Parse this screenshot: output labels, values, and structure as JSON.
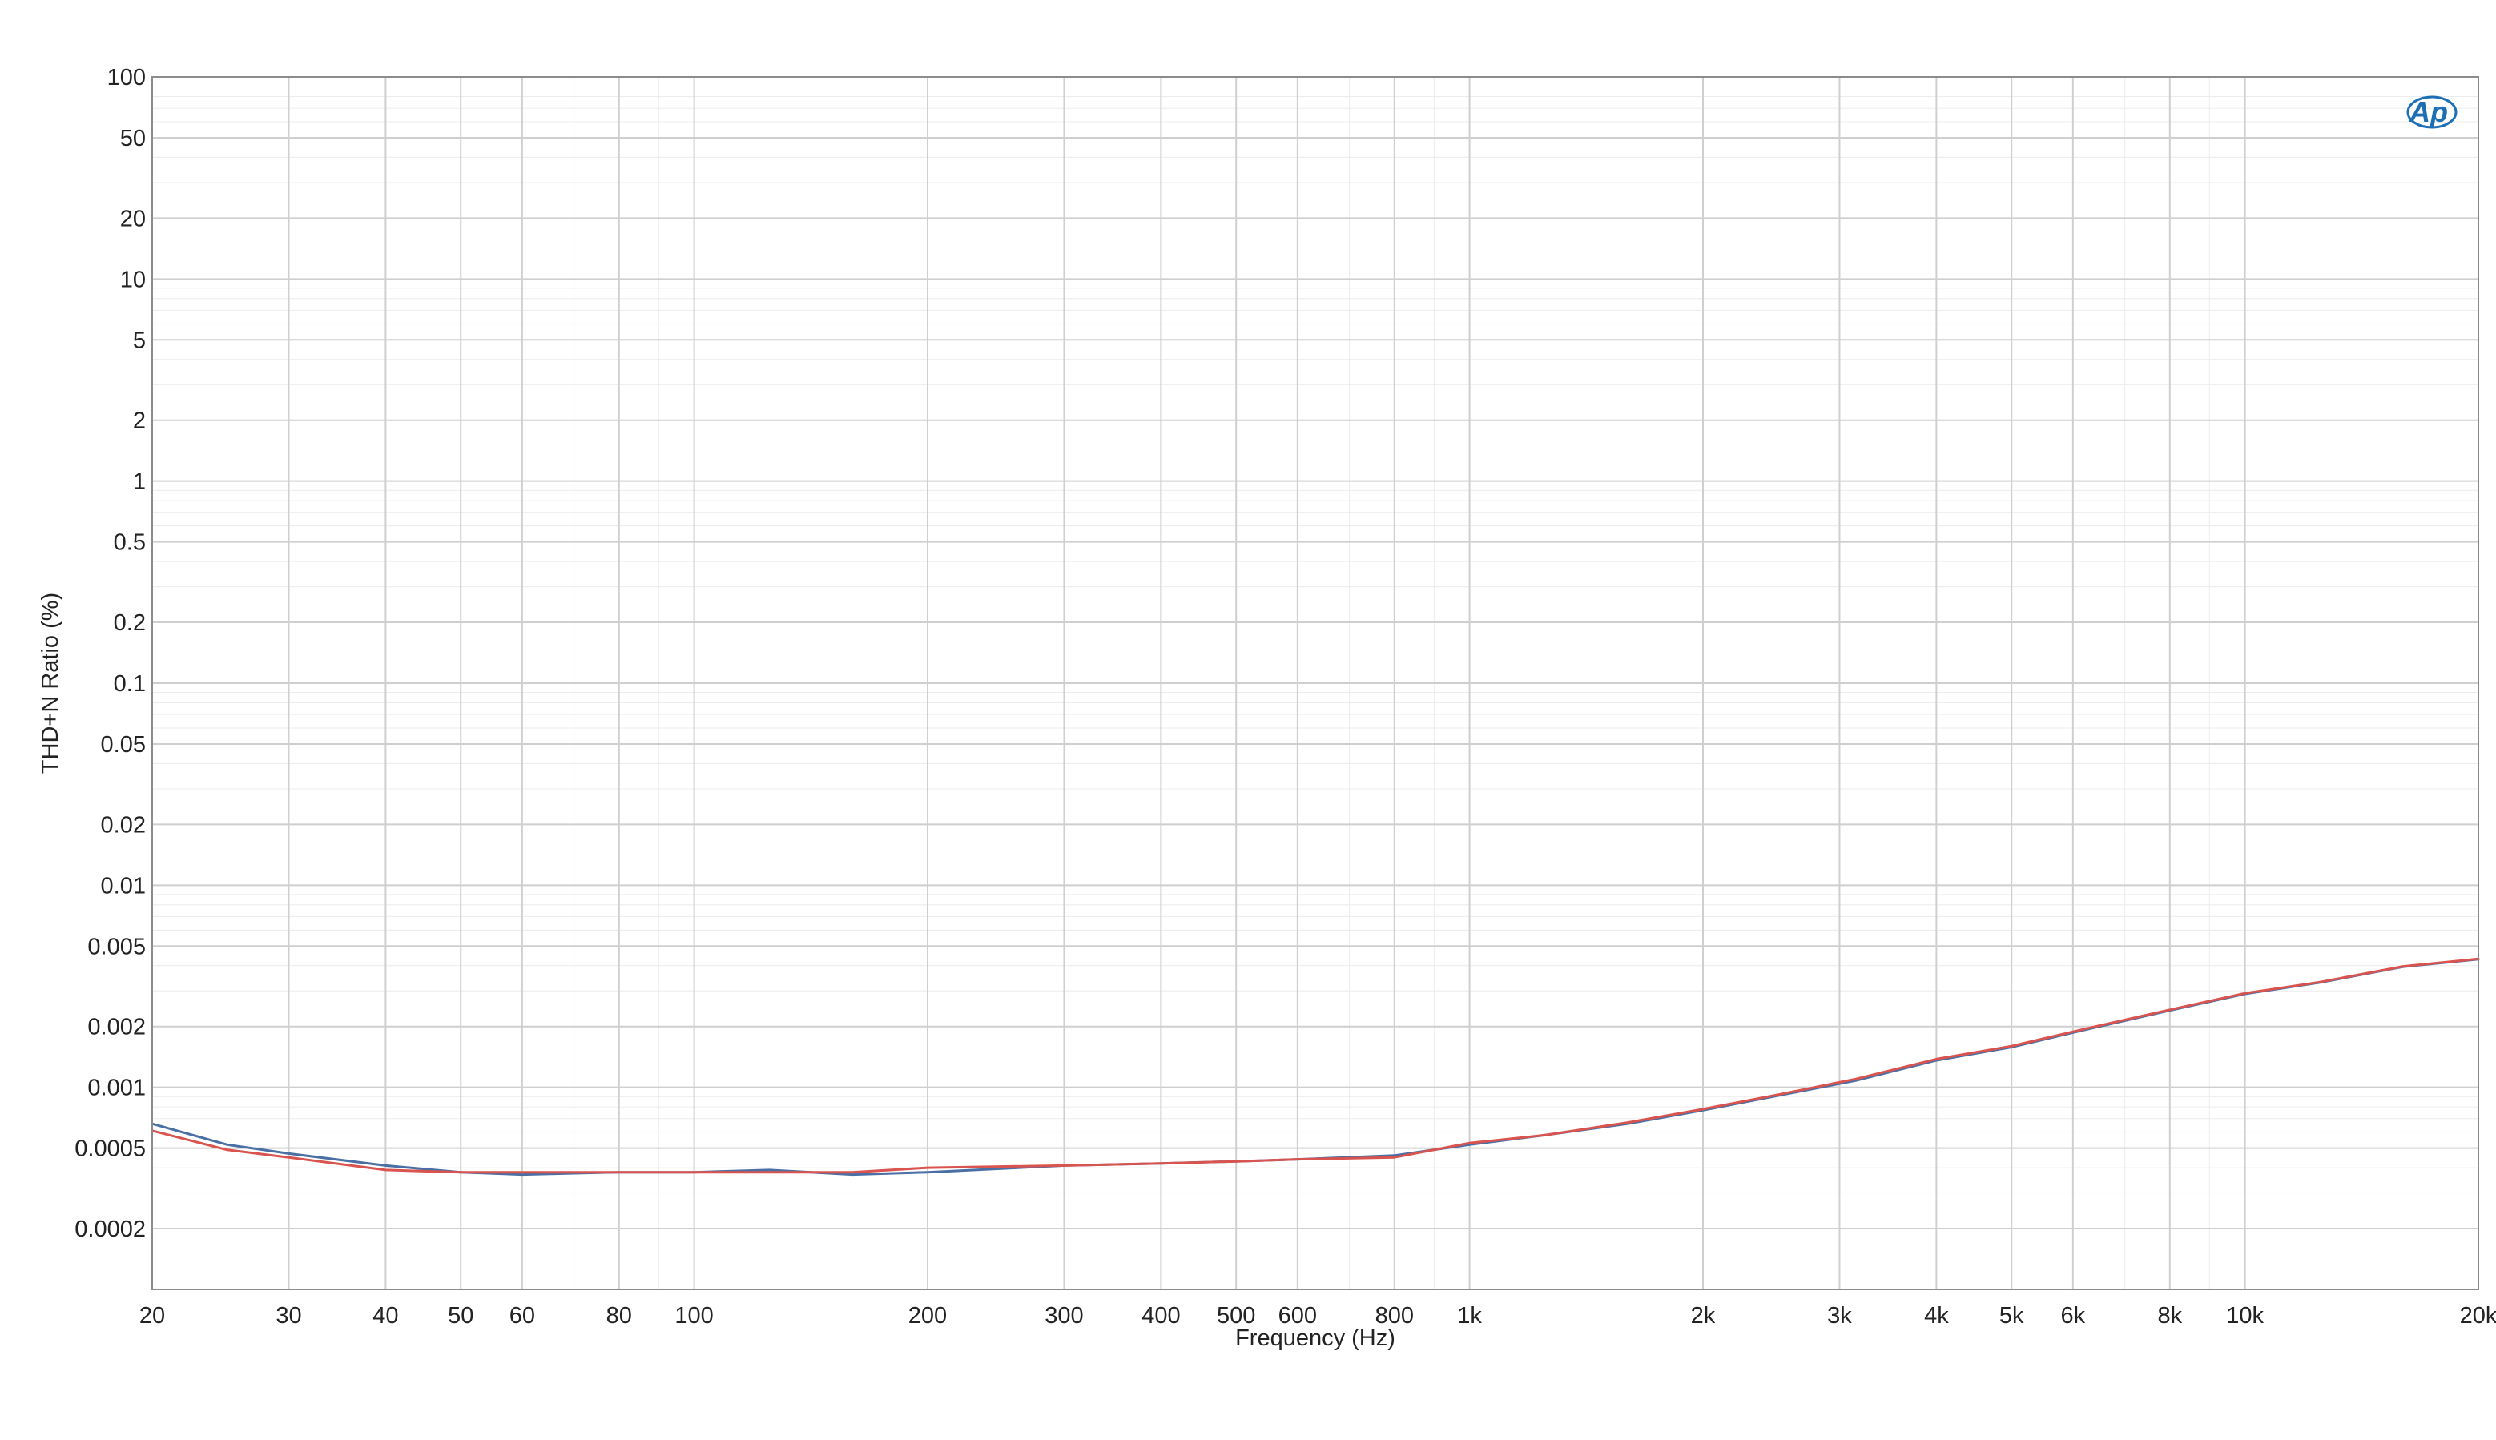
{
  "chart_data": {
    "type": "line",
    "title": "",
    "xlabel": "Frequency (Hz)",
    "ylabel": "THD+N Ratio (%)",
    "x_scale": "log",
    "y_scale": "log",
    "xlim": [
      20,
      20000
    ],
    "ylim": [
      0.0001,
      100
    ],
    "grid": true,
    "legend": "none",
    "x_ticks": [
      {
        "value": 20,
        "label": "20"
      },
      {
        "value": 30,
        "label": "30"
      },
      {
        "value": 40,
        "label": "40"
      },
      {
        "value": 50,
        "label": "50"
      },
      {
        "value": 60,
        "label": "60"
      },
      {
        "value": 80,
        "label": "80"
      },
      {
        "value": 100,
        "label": "100"
      },
      {
        "value": 200,
        "label": "200"
      },
      {
        "value": 300,
        "label": "300"
      },
      {
        "value": 400,
        "label": "400"
      },
      {
        "value": 500,
        "label": "500"
      },
      {
        "value": 600,
        "label": "600"
      },
      {
        "value": 800,
        "label": "800"
      },
      {
        "value": 1000,
        "label": "1k"
      },
      {
        "value": 2000,
        "label": "2k"
      },
      {
        "value": 3000,
        "label": "3k"
      },
      {
        "value": 4000,
        "label": "4k"
      },
      {
        "value": 5000,
        "label": "5k"
      },
      {
        "value": 6000,
        "label": "6k"
      },
      {
        "value": 8000,
        "label": "8k"
      },
      {
        "value": 10000,
        "label": "10k"
      },
      {
        "value": 20000,
        "label": "20k"
      }
    ],
    "y_ticks": [
      {
        "value": 100,
        "label": "100"
      },
      {
        "value": 50,
        "label": "50"
      },
      {
        "value": 20,
        "label": "20"
      },
      {
        "value": 10,
        "label": "10"
      },
      {
        "value": 5,
        "label": "5"
      },
      {
        "value": 2,
        "label": "2"
      },
      {
        "value": 1,
        "label": "1"
      },
      {
        "value": 0.5,
        "label": "0.5"
      },
      {
        "value": 0.2,
        "label": "0.2"
      },
      {
        "value": 0.1,
        "label": "0.1"
      },
      {
        "value": 0.05,
        "label": "0.05"
      },
      {
        "value": 0.02,
        "label": "0.02"
      },
      {
        "value": 0.01,
        "label": "0.01"
      },
      {
        "value": 0.005,
        "label": "0.005"
      },
      {
        "value": 0.002,
        "label": "0.002"
      },
      {
        "value": 0.001,
        "label": "0.001"
      },
      {
        "value": 0.0005,
        "label": "0.0005"
      },
      {
        "value": 0.0002,
        "label": "0.0002"
      }
    ],
    "series": [
      {
        "color": "#4a6fa5",
        "x": [
          20,
          25,
          30,
          40,
          50,
          60,
          80,
          100,
          125,
          160,
          200,
          300,
          400,
          500,
          600,
          800,
          1000,
          1250,
          1600,
          2000,
          2500,
          3150,
          4000,
          5000,
          6300,
          8000,
          10000,
          12500,
          16000,
          20000
        ],
        "y": [
          0.00066,
          0.00052,
          0.00047,
          0.00041,
          0.00038,
          0.00037,
          0.00038,
          0.00038,
          0.00039,
          0.00037,
          0.00038,
          0.00041,
          0.00042,
          0.00043,
          0.00044,
          0.00046,
          0.00052,
          0.00058,
          0.00066,
          0.00077,
          0.00091,
          0.00108,
          0.00136,
          0.00158,
          0.00195,
          0.0024,
          0.0029,
          0.0033,
          0.00395,
          0.0043
        ]
      },
      {
        "color": "#d9534f",
        "x": [
          20,
          25,
          30,
          40,
          50,
          60,
          80,
          100,
          125,
          160,
          200,
          300,
          400,
          500,
          600,
          800,
          1000,
          1250,
          1600,
          2000,
          2500,
          3150,
          4000,
          5000,
          6300,
          8000,
          10000,
          12500,
          16000,
          20000
        ],
        "y": [
          0.00061,
          0.00049,
          0.00045,
          0.00039,
          0.00038,
          0.00038,
          0.00038,
          0.00038,
          0.00038,
          0.00038,
          0.0004,
          0.00041,
          0.00042,
          0.00043,
          0.00044,
          0.00045,
          0.00053,
          0.00058,
          0.00067,
          0.00078,
          0.00092,
          0.0011,
          0.00138,
          0.0016,
          0.00197,
          0.00242,
          0.00292,
          0.00332,
          0.00397,
          0.00432
        ]
      }
    ]
  },
  "logo": {
    "text": "Ap"
  }
}
